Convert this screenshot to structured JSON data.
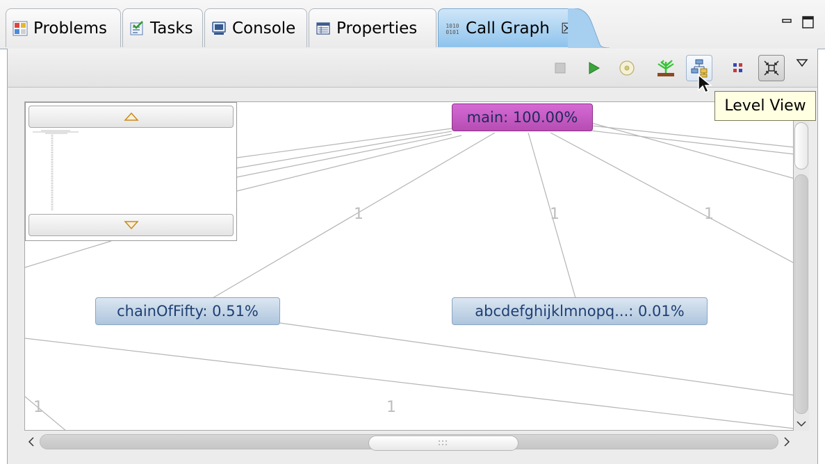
{
  "tabs": [
    {
      "label": "Problems",
      "icon": "problems-icon"
    },
    {
      "label": "Tasks",
      "icon": "tasks-icon"
    },
    {
      "label": "Console",
      "icon": "console-icon"
    },
    {
      "label": "Properties",
      "icon": "properties-icon"
    },
    {
      "label": "Call Graph",
      "icon": "call-graph-icon",
      "active": true
    }
  ],
  "window_controls": {
    "minimize": "−",
    "maximize": "□"
  },
  "close_tab_glyph": "☒",
  "toolbar": {
    "buttons": [
      {
        "name": "stop",
        "icon": "stop-icon",
        "enabled": false
      },
      {
        "name": "run",
        "icon": "play-icon"
      },
      {
        "name": "refresh",
        "icon": "disc-icon"
      },
      {
        "name": "tree-view",
        "icon": "tree-icon"
      },
      {
        "name": "level-view",
        "icon": "level-view-icon",
        "hovered": true
      },
      {
        "name": "radial-view",
        "icon": "dots-icon"
      },
      {
        "name": "fit-view",
        "icon": "fit-icon",
        "selected": true
      },
      {
        "name": "view-menu",
        "icon": "chevron-down-icon"
      }
    ]
  },
  "graph": {
    "nodes": {
      "main": "main: 100.00%",
      "chain": "chainOfFifty: 0.51%",
      "abc": "abcdefghijklmnopq...: 0.01%"
    },
    "edge_label": "1",
    "colors": {
      "main_node": "#c65ac4",
      "child_node": "#bcd0e6",
      "edge": "#b4b4b4",
      "edge_label": "#bdbdbd"
    }
  },
  "overview": {
    "up": "△",
    "down": "▽"
  },
  "scroll": {
    "left": "<",
    "right": ">",
    "down": "∨",
    "grip": "∷"
  },
  "tooltip": {
    "text": "Level View"
  }
}
